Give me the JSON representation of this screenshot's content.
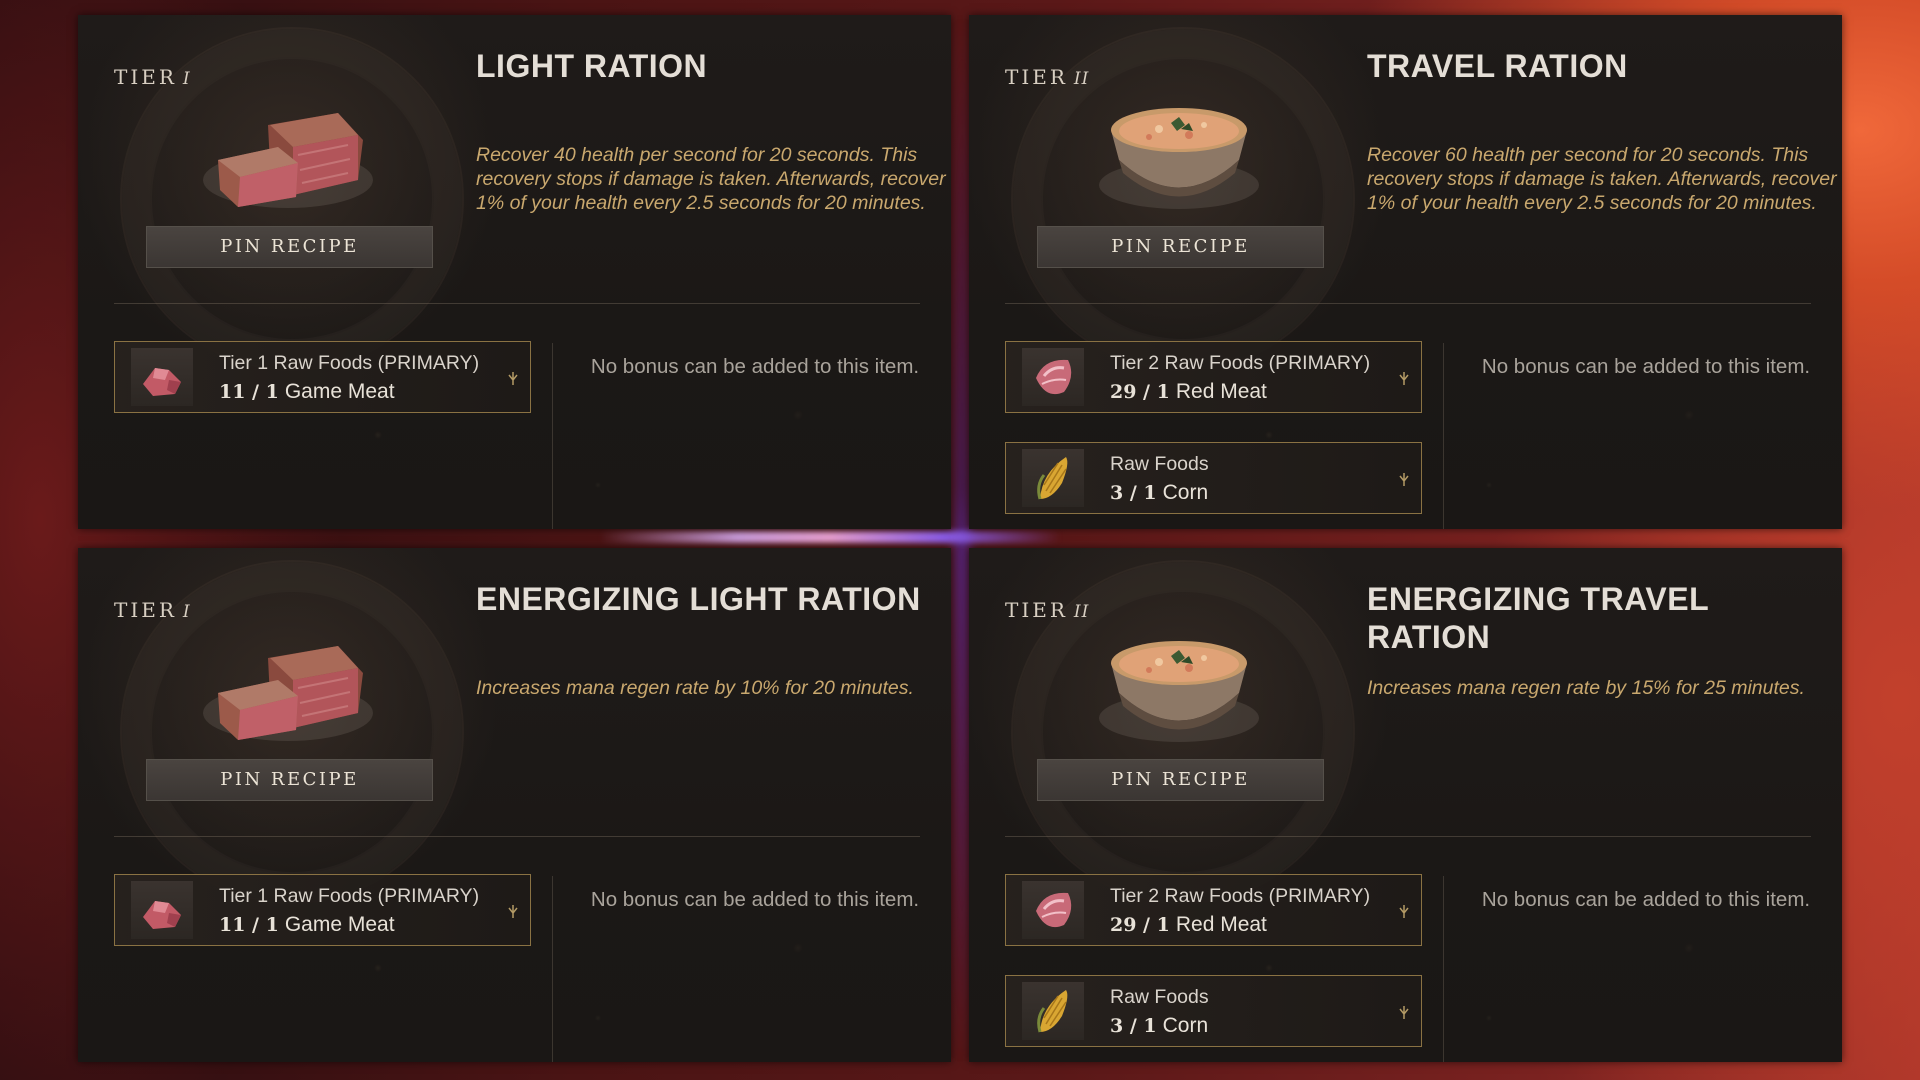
{
  "pin_label": "PIN RECIPE",
  "tier_word": "TIER",
  "cards": [
    {
      "tier_numeral": "I",
      "title": "LIGHT RATION",
      "description": "Recover 40 health per second for 20 seconds. This recovery stops if damage is taken. Afterwards, recover 1% of your health every 2.5 seconds for 20 minutes.",
      "food_icon": "steak-icon",
      "bonus_text": "No bonus can be added to this item.",
      "ingredients": [
        {
          "line1": "Tier 1 Raw Foods (PRIMARY)",
          "count": "11 / 1",
          "name": "Game Meat",
          "icon": "game-meat-icon"
        }
      ]
    },
    {
      "tier_numeral": "II",
      "title": "TRAVEL RATION",
      "description": "Recover 60 health per second for 20 seconds. This recovery stops if damage is taken. Afterwards, recover 1% of your health every 2.5 seconds for 20 minutes.",
      "food_icon": "stew-bowl-icon",
      "bonus_text": "No bonus can be added to this item.",
      "ingredients": [
        {
          "line1": "Tier 2 Raw Foods (PRIMARY)",
          "count": "29 / 1",
          "name": "Red Meat",
          "icon": "red-meat-icon"
        },
        {
          "line1": "Raw Foods",
          "count": "3 / 1",
          "name": "Corn",
          "icon": "corn-icon"
        }
      ]
    },
    {
      "tier_numeral": "I",
      "title": "ENERGIZING LIGHT RATION",
      "description": "Increases mana regen rate by 10% for 20 minutes.",
      "food_icon": "steak-icon",
      "bonus_text": "No bonus can be added to this item.",
      "ingredients": [
        {
          "line1": "Tier 1 Raw Foods (PRIMARY)",
          "count": "11 / 1",
          "name": "Game Meat",
          "icon": "game-meat-icon"
        }
      ]
    },
    {
      "tier_numeral": "II",
      "title": "ENERGIZING TRAVEL RATION",
      "description": "Increases mana regen rate by 15% for 25 minutes.",
      "food_icon": "stew-bowl-icon",
      "bonus_text": "No bonus can be added to this item.",
      "ingredients": [
        {
          "line1": "Tier 2 Raw Foods (PRIMARY)",
          "count": "29 / 1",
          "name": "Red Meat",
          "icon": "red-meat-icon"
        },
        {
          "line1": "Raw Foods",
          "count": "3 / 1",
          "name": "Corn",
          "icon": "corn-icon"
        }
      ]
    }
  ],
  "colors": {
    "accent_gold": "#c9a86e",
    "ingredient_border": "#8a7243",
    "panel_bg": "#1d1a18"
  }
}
